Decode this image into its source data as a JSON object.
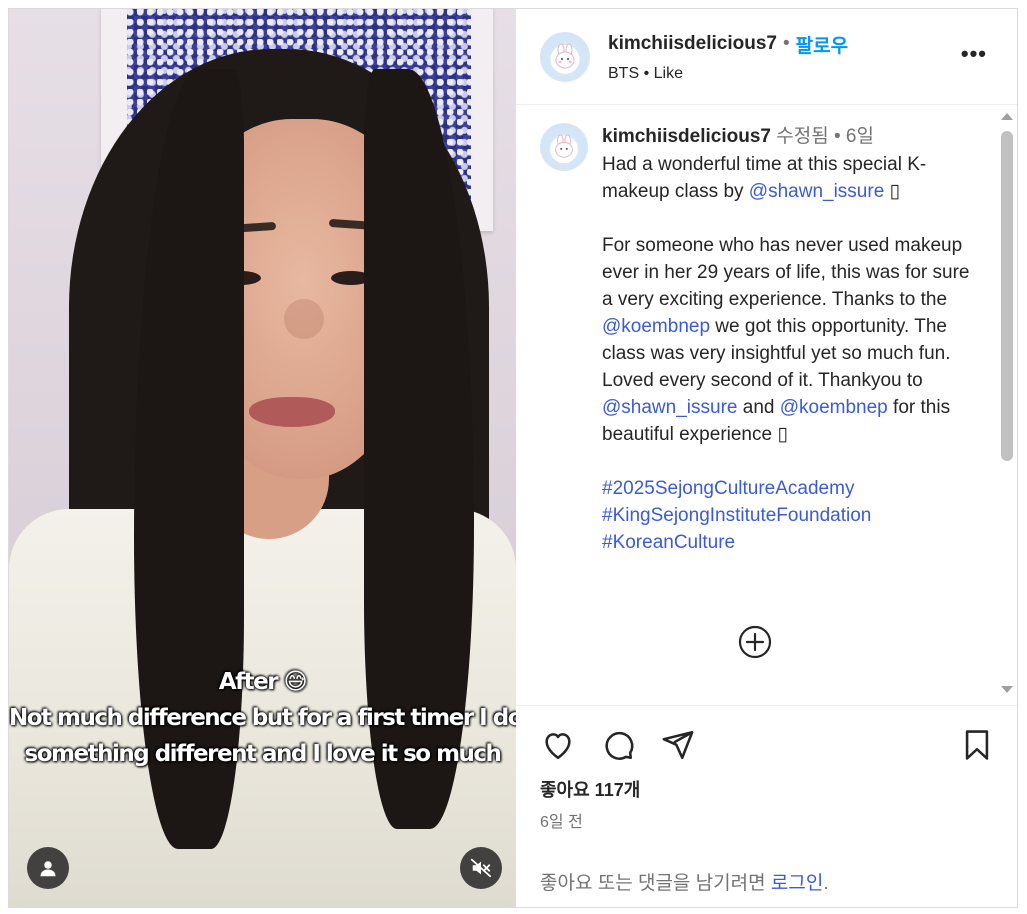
{
  "media": {
    "caption_lines": [
      "After 😅",
      "Not much difference but for a first timer I do see",
      "something different and I love it so much"
    ],
    "user_icon": "user-icon",
    "mute_icon": "muted-speaker-icon"
  },
  "header": {
    "username": "kimchiisdelicious7",
    "separator": "•",
    "follow_label": "팔로우",
    "subline": "BTS • Like",
    "more_label": "•••"
  },
  "post": {
    "username": "kimchiisdelicious7",
    "edited": "수정됨",
    "dot": "•",
    "time": "6일",
    "p1_a": "Had a wonderful time at this special K-makeup class by ",
    "p1_link": "@shawn_issure",
    "p1_b": " ▯",
    "p2_a": "For someone who has never used makeup ever in her 29 years of life, this was for sure a very exciting experience. Thanks to the ",
    "p2_link1": "@koembnep",
    "p2_b": " we got this opportunity. The class was very insightful yet so much fun. Loved every second of it. Thankyou to ",
    "p2_link2": "@shawn_issure",
    "p2_c": " and ",
    "p2_link3": "@koembnep",
    "p2_d": " for this beautiful experience ▯",
    "hashtags": [
      "#2025SejongCultureAcademy",
      "#KingSejongInstituteFoundation",
      "#KoreanCulture"
    ]
  },
  "footer": {
    "likes": "좋아요 117개",
    "time_ago": "6일 전",
    "login_prefix": "좋아요 또는 댓글을 남기려면 ",
    "login_link": "로그인",
    "login_suffix": "."
  },
  "colors": {
    "link": "#3b5bd6",
    "follow": "#0095f6",
    "muted": "#737373"
  }
}
